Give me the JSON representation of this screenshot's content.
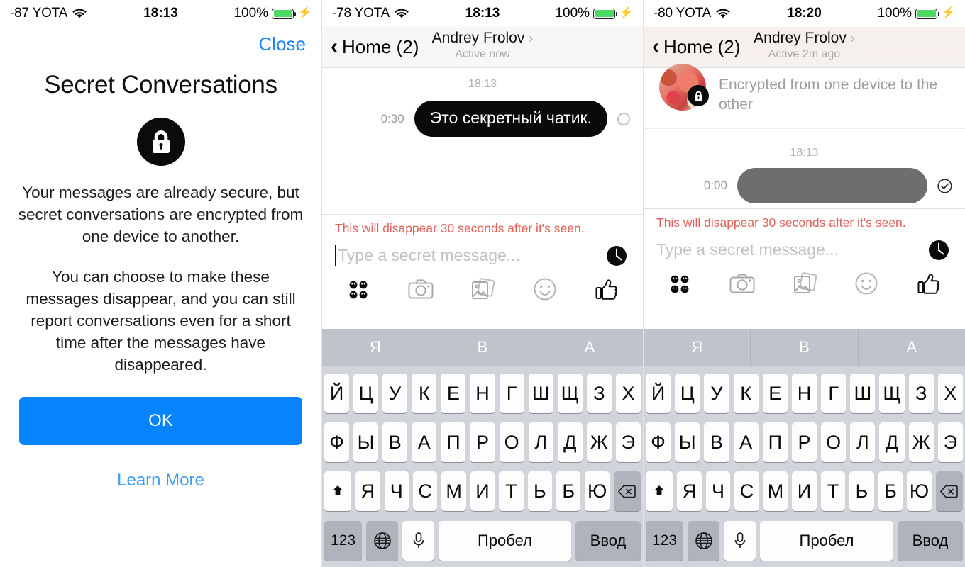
{
  "screens": [
    {
      "id": "secret-conversations-intro",
      "status": {
        "carrier": "-87 YOTA",
        "time": "18:13",
        "battery_pct": "100%",
        "wifi": "wifi-icon",
        "charging": "bolt-icon"
      },
      "close_label": "Close",
      "title": "Secret Conversations",
      "lock_icon": "lock-icon",
      "paragraph1": "Your messages are already secure, but secret conversations are encrypted from one device to another.",
      "paragraph2": "You can choose to make these messages disappear, and you can still report conversations even for a short time after the messages have disappeared.",
      "ok_label": "OK",
      "learn_more_label": "Learn More",
      "accent_blue": "#0584fe",
      "link_blue": "#1b87f7"
    },
    {
      "id": "secret-chat-sent",
      "status": {
        "carrier": "-78 YOTA",
        "time": "18:13",
        "battery_pct": "100%",
        "wifi": "wifi-icon",
        "charging": "bolt-icon"
      },
      "nav": {
        "back_label": "Home (2)",
        "title": "Andrey Frolov",
        "subtitle": "Active now",
        "chevron": "chevron-right-icon"
      },
      "chat": {
        "timestamp": "18:13",
        "countdown": "0:30",
        "message": "Это секретный чатик.",
        "status_indicator": "delivered-open-circle-icon"
      },
      "composer": {
        "note": "This will disappear 30 seconds after it's seen.",
        "placeholder": "Type a secret message...",
        "timer_icon": "disappearing-timer-icon",
        "icons": [
          "menu-dots-icon",
          "camera-icon",
          "photos-icon",
          "sticker-smiley-icon",
          "thumbs-up-icon"
        ]
      }
    },
    {
      "id": "secret-chat-expired",
      "status": {
        "carrier": "-80 YOTA",
        "time": "18:20",
        "battery_pct": "100%",
        "wifi": "wifi-icon",
        "charging": "bolt-icon"
      },
      "nav": {
        "back_label": "Home (2)",
        "title": "Andrey Frolov",
        "subtitle": "Active 2m ago",
        "chevron": "chevron-right-icon"
      },
      "encrypted_banner": {
        "avatar": "contact-avatar",
        "lock_badge": "lock-icon",
        "text": "Encrypted from one device to the other"
      },
      "chat": {
        "timestamp": "18:13",
        "countdown": "0:00",
        "message": "",
        "status_indicator": "seen-check-circle-icon"
      },
      "composer": {
        "note": "This will disappear 30 seconds after it's seen.",
        "placeholder": "Type a secret message...",
        "timer_icon": "disappearing-timer-icon",
        "icons": [
          "menu-dots-icon",
          "camera-icon",
          "photos-icon",
          "sticker-smiley-icon",
          "thumbs-up-icon"
        ]
      }
    }
  ],
  "keyboard": {
    "suggestions": [
      "Я",
      "В",
      "А"
    ],
    "row1": [
      "Й",
      "Ц",
      "У",
      "К",
      "Е",
      "Н",
      "Г",
      "Ш",
      "Щ",
      "З",
      "Х"
    ],
    "row2": [
      "Ф",
      "Ы",
      "В",
      "А",
      "П",
      "Р",
      "О",
      "Л",
      "Д",
      "Ж",
      "Э"
    ],
    "row3": [
      "Я",
      "Ч",
      "С",
      "М",
      "И",
      "Т",
      "Ь",
      "Б",
      "Ю"
    ],
    "shift": "shift-icon",
    "backspace": "backspace-icon",
    "numbers_label": "123",
    "globe": "globe-icon",
    "mic": "microphone-icon",
    "space_label": "Пробел",
    "enter_label": "Ввод"
  }
}
